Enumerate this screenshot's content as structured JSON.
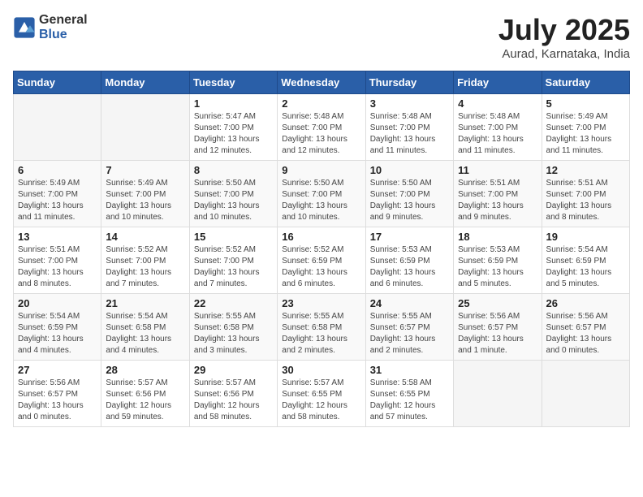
{
  "header": {
    "logo": {
      "text_general": "General",
      "text_blue": "Blue"
    },
    "title": "July 2025",
    "subtitle": "Aurad, Karnataka, India"
  },
  "calendar": {
    "headers": [
      "Sunday",
      "Monday",
      "Tuesday",
      "Wednesday",
      "Thursday",
      "Friday",
      "Saturday"
    ],
    "weeks": [
      [
        {
          "day": "",
          "info": ""
        },
        {
          "day": "",
          "info": ""
        },
        {
          "day": "1",
          "info": "Sunrise: 5:47 AM\nSunset: 7:00 PM\nDaylight: 13 hours and 12 minutes."
        },
        {
          "day": "2",
          "info": "Sunrise: 5:48 AM\nSunset: 7:00 PM\nDaylight: 13 hours and 12 minutes."
        },
        {
          "day": "3",
          "info": "Sunrise: 5:48 AM\nSunset: 7:00 PM\nDaylight: 13 hours and 11 minutes."
        },
        {
          "day": "4",
          "info": "Sunrise: 5:48 AM\nSunset: 7:00 PM\nDaylight: 13 hours and 11 minutes."
        },
        {
          "day": "5",
          "info": "Sunrise: 5:49 AM\nSunset: 7:00 PM\nDaylight: 13 hours and 11 minutes."
        }
      ],
      [
        {
          "day": "6",
          "info": "Sunrise: 5:49 AM\nSunset: 7:00 PM\nDaylight: 13 hours and 11 minutes."
        },
        {
          "day": "7",
          "info": "Sunrise: 5:49 AM\nSunset: 7:00 PM\nDaylight: 13 hours and 10 minutes."
        },
        {
          "day": "8",
          "info": "Sunrise: 5:50 AM\nSunset: 7:00 PM\nDaylight: 13 hours and 10 minutes."
        },
        {
          "day": "9",
          "info": "Sunrise: 5:50 AM\nSunset: 7:00 PM\nDaylight: 13 hours and 10 minutes."
        },
        {
          "day": "10",
          "info": "Sunrise: 5:50 AM\nSunset: 7:00 PM\nDaylight: 13 hours and 9 minutes."
        },
        {
          "day": "11",
          "info": "Sunrise: 5:51 AM\nSunset: 7:00 PM\nDaylight: 13 hours and 9 minutes."
        },
        {
          "day": "12",
          "info": "Sunrise: 5:51 AM\nSunset: 7:00 PM\nDaylight: 13 hours and 8 minutes."
        }
      ],
      [
        {
          "day": "13",
          "info": "Sunrise: 5:51 AM\nSunset: 7:00 PM\nDaylight: 13 hours and 8 minutes."
        },
        {
          "day": "14",
          "info": "Sunrise: 5:52 AM\nSunset: 7:00 PM\nDaylight: 13 hours and 7 minutes."
        },
        {
          "day": "15",
          "info": "Sunrise: 5:52 AM\nSunset: 7:00 PM\nDaylight: 13 hours and 7 minutes."
        },
        {
          "day": "16",
          "info": "Sunrise: 5:52 AM\nSunset: 6:59 PM\nDaylight: 13 hours and 6 minutes."
        },
        {
          "day": "17",
          "info": "Sunrise: 5:53 AM\nSunset: 6:59 PM\nDaylight: 13 hours and 6 minutes."
        },
        {
          "day": "18",
          "info": "Sunrise: 5:53 AM\nSunset: 6:59 PM\nDaylight: 13 hours and 5 minutes."
        },
        {
          "day": "19",
          "info": "Sunrise: 5:54 AM\nSunset: 6:59 PM\nDaylight: 13 hours and 5 minutes."
        }
      ],
      [
        {
          "day": "20",
          "info": "Sunrise: 5:54 AM\nSunset: 6:59 PM\nDaylight: 13 hours and 4 minutes."
        },
        {
          "day": "21",
          "info": "Sunrise: 5:54 AM\nSunset: 6:58 PM\nDaylight: 13 hours and 4 minutes."
        },
        {
          "day": "22",
          "info": "Sunrise: 5:55 AM\nSunset: 6:58 PM\nDaylight: 13 hours and 3 minutes."
        },
        {
          "day": "23",
          "info": "Sunrise: 5:55 AM\nSunset: 6:58 PM\nDaylight: 13 hours and 2 minutes."
        },
        {
          "day": "24",
          "info": "Sunrise: 5:55 AM\nSunset: 6:57 PM\nDaylight: 13 hours and 2 minutes."
        },
        {
          "day": "25",
          "info": "Sunrise: 5:56 AM\nSunset: 6:57 PM\nDaylight: 13 hours and 1 minute."
        },
        {
          "day": "26",
          "info": "Sunrise: 5:56 AM\nSunset: 6:57 PM\nDaylight: 13 hours and 0 minutes."
        }
      ],
      [
        {
          "day": "27",
          "info": "Sunrise: 5:56 AM\nSunset: 6:57 PM\nDaylight: 13 hours and 0 minutes."
        },
        {
          "day": "28",
          "info": "Sunrise: 5:57 AM\nSunset: 6:56 PM\nDaylight: 12 hours and 59 minutes."
        },
        {
          "day": "29",
          "info": "Sunrise: 5:57 AM\nSunset: 6:56 PM\nDaylight: 12 hours and 58 minutes."
        },
        {
          "day": "30",
          "info": "Sunrise: 5:57 AM\nSunset: 6:55 PM\nDaylight: 12 hours and 58 minutes."
        },
        {
          "day": "31",
          "info": "Sunrise: 5:58 AM\nSunset: 6:55 PM\nDaylight: 12 hours and 57 minutes."
        },
        {
          "day": "",
          "info": ""
        },
        {
          "day": "",
          "info": ""
        }
      ]
    ]
  }
}
